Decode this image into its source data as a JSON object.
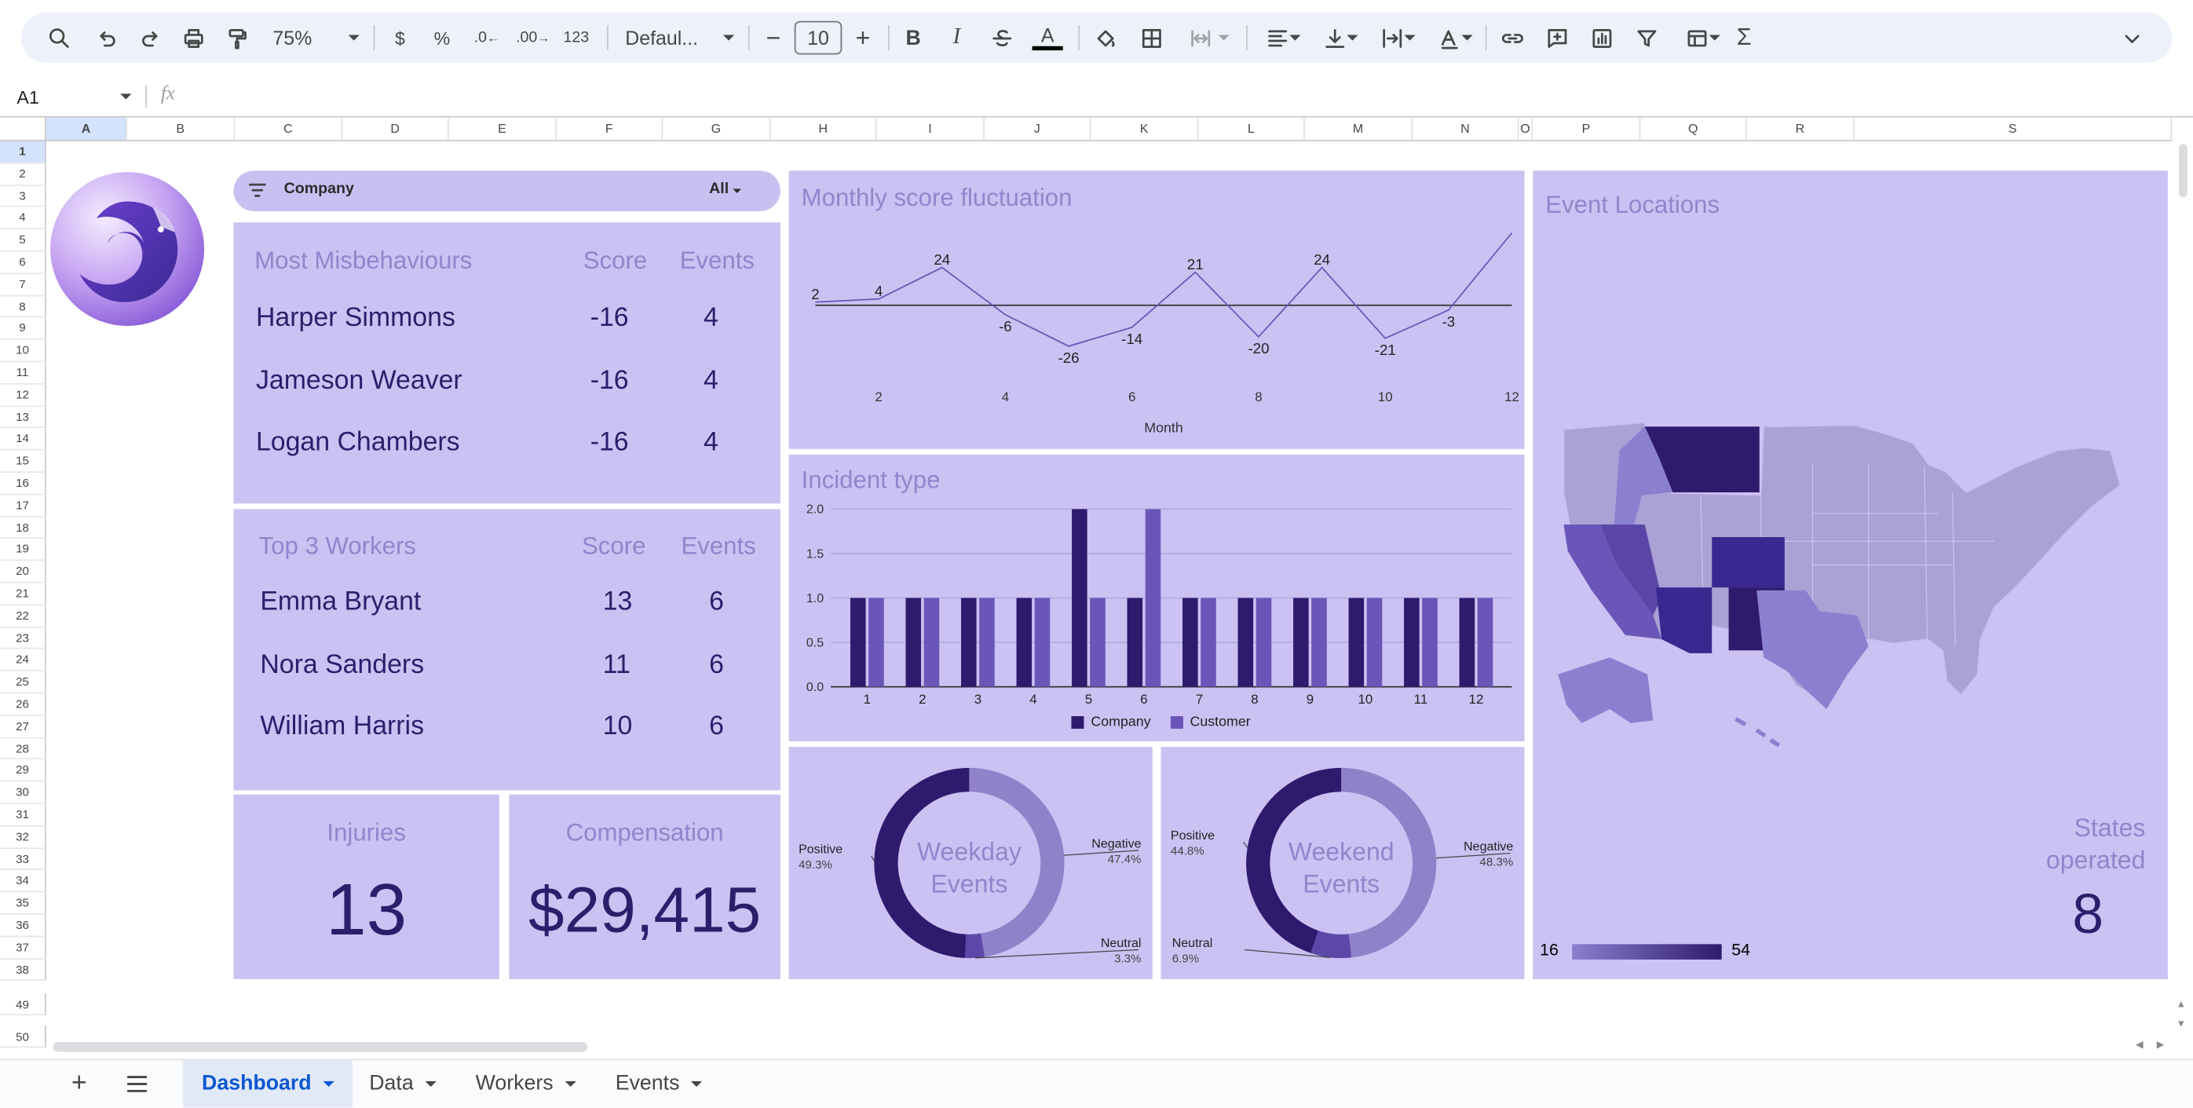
{
  "toolbar": {
    "zoom": "75%",
    "currency": "$",
    "percent": "%",
    "dec_decrease": ".0",
    "dec_increase": ".00",
    "number_format": "123",
    "font": "Defaul...",
    "font_size": "10",
    "bold": "B",
    "italic": "I",
    "text_color": "A",
    "sum": "Σ"
  },
  "formula_bar": {
    "cell_ref": "A1",
    "fx": "fx",
    "value": ""
  },
  "columns": [
    "A",
    "B",
    "C",
    "D",
    "E",
    "F",
    "G",
    "H",
    "I",
    "J",
    "K",
    "L",
    "M",
    "N",
    "O",
    "P",
    "Q",
    "R",
    "S"
  ],
  "rows": [
    "1",
    "2",
    "3",
    "4",
    "5",
    "6",
    "7",
    "8",
    "9",
    "10",
    "11",
    "12",
    "13",
    "14",
    "15",
    "16",
    "17",
    "18",
    "19",
    "20",
    "21",
    "22",
    "23",
    "24",
    "25",
    "26",
    "27",
    "28",
    "29",
    "30",
    "31",
    "32",
    "33",
    "34",
    "35",
    "36",
    "37",
    "38",
    "49",
    "50"
  ],
  "filter": {
    "label": "Company",
    "value": "All"
  },
  "misbehaviours": {
    "title": "Most Misbehaviours",
    "col_score": "Score",
    "col_events": "Events",
    "rows": [
      {
        "name": "Harper Simmons",
        "score": "-16",
        "events": "4"
      },
      {
        "name": "Jameson Weaver",
        "score": "-16",
        "events": "4"
      },
      {
        "name": "Logan Chambers",
        "score": "-16",
        "events": "4"
      }
    ]
  },
  "top_workers": {
    "title": "Top 3 Workers",
    "col_score": "Score",
    "col_events": "Events",
    "rows": [
      {
        "name": "Emma Bryant",
        "score": "13",
        "events": "6"
      },
      {
        "name": "Nora Sanders",
        "score": "11",
        "events": "6"
      },
      {
        "name": "William Harris",
        "score": "10",
        "events": "6"
      }
    ]
  },
  "injuries": {
    "title": "Injuries",
    "value": "13"
  },
  "compensation": {
    "title": "Compensation",
    "value": "$29,415"
  },
  "map": {
    "title": "Event Locations",
    "states_label_1": "States",
    "states_label_2": "operated",
    "states_value": "8",
    "legend_min": "16",
    "legend_max": "54",
    "color_low": "#8b7fd0",
    "color_high": "#2e1b6e"
  },
  "tabs": [
    "Dashboard",
    "Data",
    "Workers",
    "Events"
  ],
  "active_tab": "Dashboard",
  "colors": {
    "panel": "#cbc2f3",
    "dark": "#2e1b6e",
    "mid": "#6a56b8",
    "light": "#8f82c9"
  },
  "chart_data": [
    {
      "type": "line",
      "title": "Monthly score fluctuation",
      "xlabel": "Month",
      "x": [
        1,
        2,
        3,
        4,
        5,
        6,
        7,
        8,
        9,
        10,
        11,
        12
      ],
      "y": [
        2,
        4,
        24,
        -6,
        -26,
        -14,
        21,
        -20,
        24,
        -21,
        -3,
        46
      ],
      "point_labels": [
        "2",
        "4",
        "24",
        "-6",
        "-26",
        "-14",
        "21",
        "-20",
        "24",
        "-21",
        "-3",
        ""
      ],
      "xticks": [
        "2",
        "4",
        "6",
        "8",
        "10",
        "12"
      ],
      "ylim": [
        -30,
        50
      ]
    },
    {
      "type": "bar",
      "title": "Incident type",
      "categories": [
        "1",
        "2",
        "3",
        "4",
        "5",
        "6",
        "7",
        "8",
        "9",
        "10",
        "11",
        "12"
      ],
      "series": [
        {
          "name": "Company",
          "values": [
            1,
            1,
            1,
            1,
            2,
            1,
            1,
            1,
            1,
            1,
            1,
            1
          ]
        },
        {
          "name": "Customer",
          "values": [
            1,
            1,
            1,
            1,
            1,
            2,
            1,
            1,
            1,
            1,
            1,
            1
          ]
        }
      ],
      "yticks": [
        "0.0",
        "0.5",
        "1.0",
        "1.5",
        "2.0"
      ],
      "ylim": [
        0,
        2
      ]
    },
    {
      "type": "pie",
      "title": "Weekday Events",
      "center_1": "Weekday",
      "center_2": "Events",
      "slices": [
        {
          "label": "Negative",
          "pct": "47.4%",
          "value": 47.4
        },
        {
          "label": "Neutral",
          "pct": "3.3%",
          "value": 3.3
        },
        {
          "label": "Positive",
          "pct": "49.3%",
          "value": 49.3
        }
      ]
    },
    {
      "type": "pie",
      "title": "Weekend Events",
      "center_1": "Weekend",
      "center_2": "Events",
      "slices": [
        {
          "label": "Negative",
          "pct": "48.3%",
          "value": 48.3
        },
        {
          "label": "Neutral",
          "pct": "6.9%",
          "value": 6.9
        },
        {
          "label": "Positive",
          "pct": "44.8%",
          "value": 44.8
        }
      ]
    }
  ]
}
